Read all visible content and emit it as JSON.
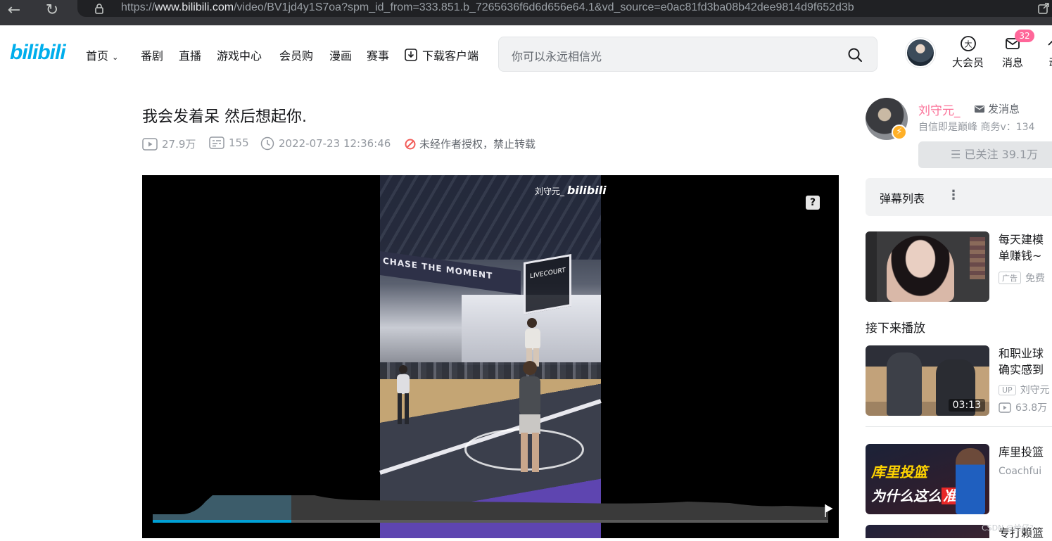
{
  "browser": {
    "url_prefix": "https://",
    "url_domain": "www.bilibili.com",
    "url_rest": "/video/BV1jd4y1S7oa?spm_id_from=333.851.b_7265636f6d6d656e64.1&vd_source=e0ac81fd3ba08b42dee9814d9f652d3b"
  },
  "header": {
    "logo": "bilibili",
    "nav": [
      "首页",
      "番剧",
      "直播",
      "游戏中心",
      "会员购",
      "漫画",
      "赛事",
      "下载客户端"
    ],
    "search_placeholder": "你可以永远相信光",
    "vip_label": "大会员",
    "message_label": "消息",
    "message_badge": "32",
    "dynamic_label": "动"
  },
  "video": {
    "title": "我会发着呆 然后想起你.",
    "views": "27.9万",
    "danmaku_count": "155",
    "date": "2022-07-23 12:36:46",
    "copyright": "未经作者授权，禁止转载",
    "watermark_user": "刘守元_",
    "watermark_brand": "bilibili",
    "court_banner": "CHASE THE MOMENT",
    "court_board": "LIVECOURT",
    "help_glyph": "?",
    "progress": 0.205
  },
  "uploader": {
    "name": "刘守元_",
    "message_btn": "发消息",
    "description": "自信即是巅峰 商务v：134",
    "follow_btn": "已关注 39.1万",
    "badge_glyph": "⚡"
  },
  "sidebar": {
    "danmaku_list": "弹幕列表",
    "ad": {
      "title_line1": "每天建模",
      "title_line2": "单赚钱~",
      "tag": "广告",
      "sub": "免费"
    },
    "next_label": "接下来播放",
    "next_video": {
      "title_line1": "和职业球",
      "title_line2": "确实感到",
      "up": "刘守元",
      "views": "63.8万",
      "duration": "03:13",
      "up_tag": "UP"
    },
    "rec_video": {
      "title_line1": "库里投篮",
      "up": "Coachfui",
      "thumb_text1": "库里投篮",
      "thumb_text2_a": "为什么这么",
      "thumb_text2_b": "准",
      "thumb_text2_c": "！"
    },
    "rec_video2_title": "专打赖篮"
  },
  "footer_watermark": "CSDN @给仔?",
  "colors": {
    "brand_blue": "#00aeec",
    "pink": "#fb7299",
    "progress": "#00a1d6"
  }
}
